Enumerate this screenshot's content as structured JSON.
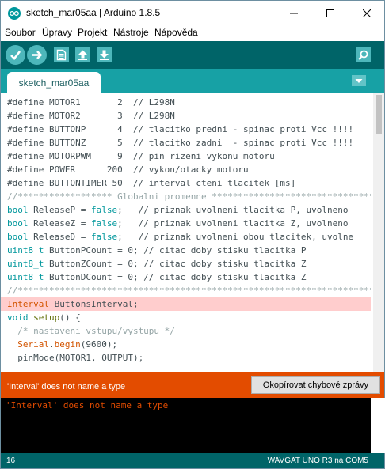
{
  "window": {
    "title": "sketch_mar05aa | Arduino 1.8.5"
  },
  "menu": [
    "Soubor",
    "Úpravy",
    "Projekt",
    "Nástroje",
    "Nápověda"
  ],
  "colors": {
    "toolbar": "#006468",
    "tabbar": "#17a1a5",
    "button": "#4db7bb",
    "error_bar": "#e34c00",
    "error_line": "#ffcdcd",
    "console": "#000000"
  },
  "toolbar": {
    "icons": [
      "verify-icon",
      "upload-icon",
      "new-icon",
      "open-icon",
      "save-icon",
      "serial-monitor-icon"
    ]
  },
  "tabs": [
    {
      "label": "sketch_mar05aa"
    }
  ],
  "code": [
    [
      {
        "t": "#define MOTOR1       2  // L298N",
        "c": "#434f54"
      }
    ],
    [
      {
        "t": "#define MOTOR2       3  // L298N",
        "c": "#434f54"
      }
    ],
    [
      {
        "t": "#define BUTTONP      4  // tlacitko predni - spinac proti Vcc !!!!",
        "c": "#434f54"
      }
    ],
    [
      {
        "t": "#define BUTTONZ      5  // tlacitko zadni  - spinac proti Vcc !!!!",
        "c": "#434f54"
      }
    ],
    [
      {
        "t": "#define MOTORPWM     9  // pin rizeni vykonu motoru",
        "c": "#434f54"
      }
    ],
    [
      {
        "t": "#define POWER      200  // vykon/otacky motoru",
        "c": "#434f54"
      }
    ],
    [
      {
        "t": "#define BUTTONTIMER 50  // interval cteni tlacitek [ms]",
        "c": "#434f54"
      }
    ],
    [
      {
        "t": "//****************** Globalni promenne *******************************",
        "c": "#95a5a6"
      }
    ],
    [
      {
        "t": "bool",
        "c": "#00979c"
      },
      {
        "t": " ReleaseP = ",
        "c": "#434f54"
      },
      {
        "t": "false",
        "c": "#00979c"
      },
      {
        "t": ";   // priznak uvolneni tlacitka P, uvolneno",
        "c": "#434f54"
      }
    ],
    [
      {
        "t": "bool",
        "c": "#00979c"
      },
      {
        "t": " ReleaseZ = ",
        "c": "#434f54"
      },
      {
        "t": "false",
        "c": "#00979c"
      },
      {
        "t": ";   // priznak uvolneni tlacitka Z, uvolneno",
        "c": "#434f54"
      }
    ],
    [
      {
        "t": "bool",
        "c": "#00979c"
      },
      {
        "t": " ReleaseD = ",
        "c": "#434f54"
      },
      {
        "t": "false",
        "c": "#00979c"
      },
      {
        "t": ";   // priznak uvolneni obou tlacitek, uvolne",
        "c": "#434f54"
      }
    ],
    [
      {
        "t": "uint8_t",
        "c": "#00979c"
      },
      {
        "t": " ButtonPCount = 0; // citac doby stisku tlacitka P",
        "c": "#434f54"
      }
    ],
    [
      {
        "t": "uint8_t",
        "c": "#00979c"
      },
      {
        "t": " ButtonZCount = 0; // citac doby stisku tlacitka Z",
        "c": "#434f54"
      }
    ],
    [
      {
        "t": "uint8_t",
        "c": "#00979c"
      },
      {
        "t": " ButtonDCount = 0; // citac doby stisku tlacitka Z",
        "c": "#434f54"
      }
    ],
    [
      {
        "t": "//*********************************************************************",
        "c": "#95a5a6"
      }
    ],
    [
      {
        "t": "Interval",
        "c": "#d35400"
      },
      {
        "t": " ButtonsInterval;",
        "c": "#434f54"
      }
    ],
    [
      {
        "t": "void",
        "c": "#00979c"
      },
      {
        "t": " ",
        "c": "#434f54"
      },
      {
        "t": "setup",
        "c": "#5e6d03"
      },
      {
        "t": "() {",
        "c": "#434f54"
      }
    ],
    [
      {
        "t": "  /* nastaveni vstupu/vystupu */",
        "c": "#95a5a6"
      }
    ],
    [
      {
        "t": "  ",
        "c": "#434f54"
      },
      {
        "t": "Serial",
        "c": "#d35400"
      },
      {
        "t": ".",
        "c": "#434f54"
      },
      {
        "t": "begin",
        "c": "#d35400"
      },
      {
        "t": "(9600);",
        "c": "#434f54"
      }
    ],
    [
      {
        "t": "  pinMode(MOTOR1, OUTPUT);",
        "c": "#434f54"
      }
    ]
  ],
  "error_line_index": 15,
  "status": {
    "message": "'Interval' does not name a type",
    "copy_button": "Okopírovat chybové zprávy"
  },
  "console": {
    "text": "'Interval' does not name a type"
  },
  "footer": {
    "line": "16",
    "board": "WAVGAT UNO R3 na COM5"
  }
}
